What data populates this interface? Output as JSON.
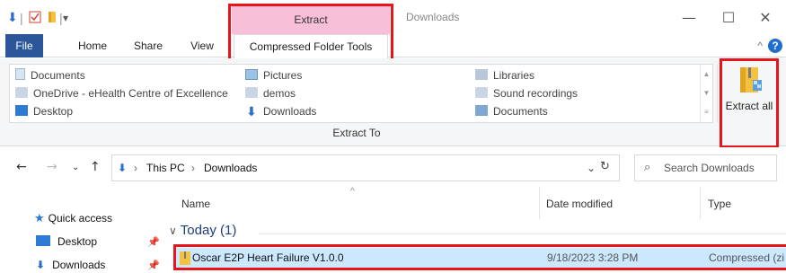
{
  "title_bar": {
    "context_group_label": "Extract",
    "window_title": "Downloads",
    "minimize_glyph": "—",
    "maximize_glyph": "☐",
    "close_glyph": "✕"
  },
  "tabs": {
    "file": "File",
    "home": "Home",
    "share": "Share",
    "view": "View",
    "compressed": "Compressed Folder Tools"
  },
  "ribbon": {
    "gallery": [
      {
        "label": "Documents",
        "icon": "document-icon"
      },
      {
        "label": "OneDrive - eHealth Centre of Excellence",
        "icon": "folder-icon"
      },
      {
        "label": "Desktop",
        "icon": "desktop-icon"
      },
      {
        "label": "Pictures",
        "icon": "pictures-icon"
      },
      {
        "label": "demos",
        "icon": "folder-icon"
      },
      {
        "label": "Downloads",
        "icon": "download-icon"
      },
      {
        "label": "Libraries",
        "icon": "libraries-icon"
      },
      {
        "label": "Sound recordings",
        "icon": "folder-icon"
      },
      {
        "label": "Documents",
        "icon": "documents-library-icon"
      }
    ],
    "group_label": "Extract To",
    "extract_all": "Extract all"
  },
  "address_bar": {
    "crumbs": [
      "This PC",
      "Downloads"
    ],
    "search_placeholder": "Search Downloads"
  },
  "nav_pane": {
    "items": [
      {
        "label": "Quick access"
      },
      {
        "label": "Desktop"
      },
      {
        "label": "Downloads"
      }
    ]
  },
  "file_list": {
    "columns": {
      "name": "Name",
      "date": "Date modified",
      "type": "Type"
    },
    "group": "Today (1)",
    "rows": [
      {
        "name": "Oscar E2P Heart Failure V1.0.0",
        "date": "9/18/2023 3:28 PM",
        "type": "Compressed (zi"
      }
    ]
  },
  "colors": {
    "accent": "#2b579a",
    "context_tab": "#f8c0d8",
    "highlight": "#e8141c",
    "selection": "#cce8ff"
  }
}
